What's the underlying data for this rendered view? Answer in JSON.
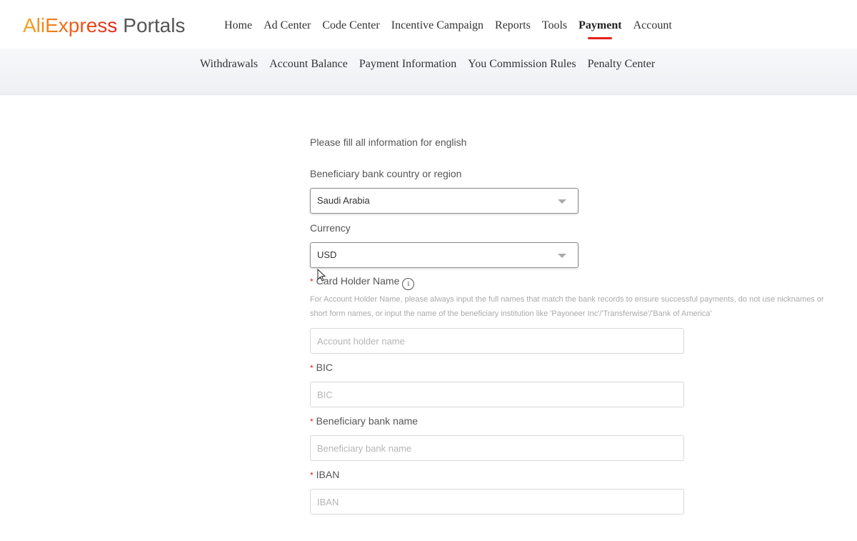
{
  "header": {
    "logo_brand": "AliExpress",
    "logo_sub": "Portals",
    "nav": [
      {
        "label": "Home"
      },
      {
        "label": "Ad Center"
      },
      {
        "label": "Code Center"
      },
      {
        "label": "Incentive Campaign"
      },
      {
        "label": "Reports"
      },
      {
        "label": "Tools"
      },
      {
        "label": "Payment",
        "active": true
      },
      {
        "label": "Account"
      }
    ]
  },
  "subnav": [
    {
      "label": "Withdrawals"
    },
    {
      "label": "Account Balance"
    },
    {
      "label": "Payment Information"
    },
    {
      "label": "You Commission Rules"
    },
    {
      "label": "Penalty Center"
    }
  ],
  "form": {
    "note": "Please fill all information for english",
    "country": {
      "label": "Beneficiary bank country or region",
      "value": "Saudi Arabia"
    },
    "currency": {
      "label": "Currency",
      "value": "USD"
    },
    "holder": {
      "label": "Card Holder Name",
      "hint": "For Account Holder Name, please always input the full names that match the bank records to ensure successful payments, do not use nicknames or short form names, or input the name of the beneficiary institution like 'Payoneer Inc'/'Transferwise'/'Bank of America'",
      "placeholder": "Account holder name"
    },
    "bic": {
      "label": "BIC",
      "placeholder": "BIC"
    },
    "bank_name": {
      "label": "Beneficiary bank name",
      "placeholder": "Beneficiary bank name"
    },
    "iban": {
      "label": "IBAN",
      "placeholder": "IBAN"
    },
    "required_mark": "*",
    "info_glyph": "i"
  },
  "colors": {
    "accent": "#e2231a",
    "brand_orange": "#f06a1a"
  }
}
